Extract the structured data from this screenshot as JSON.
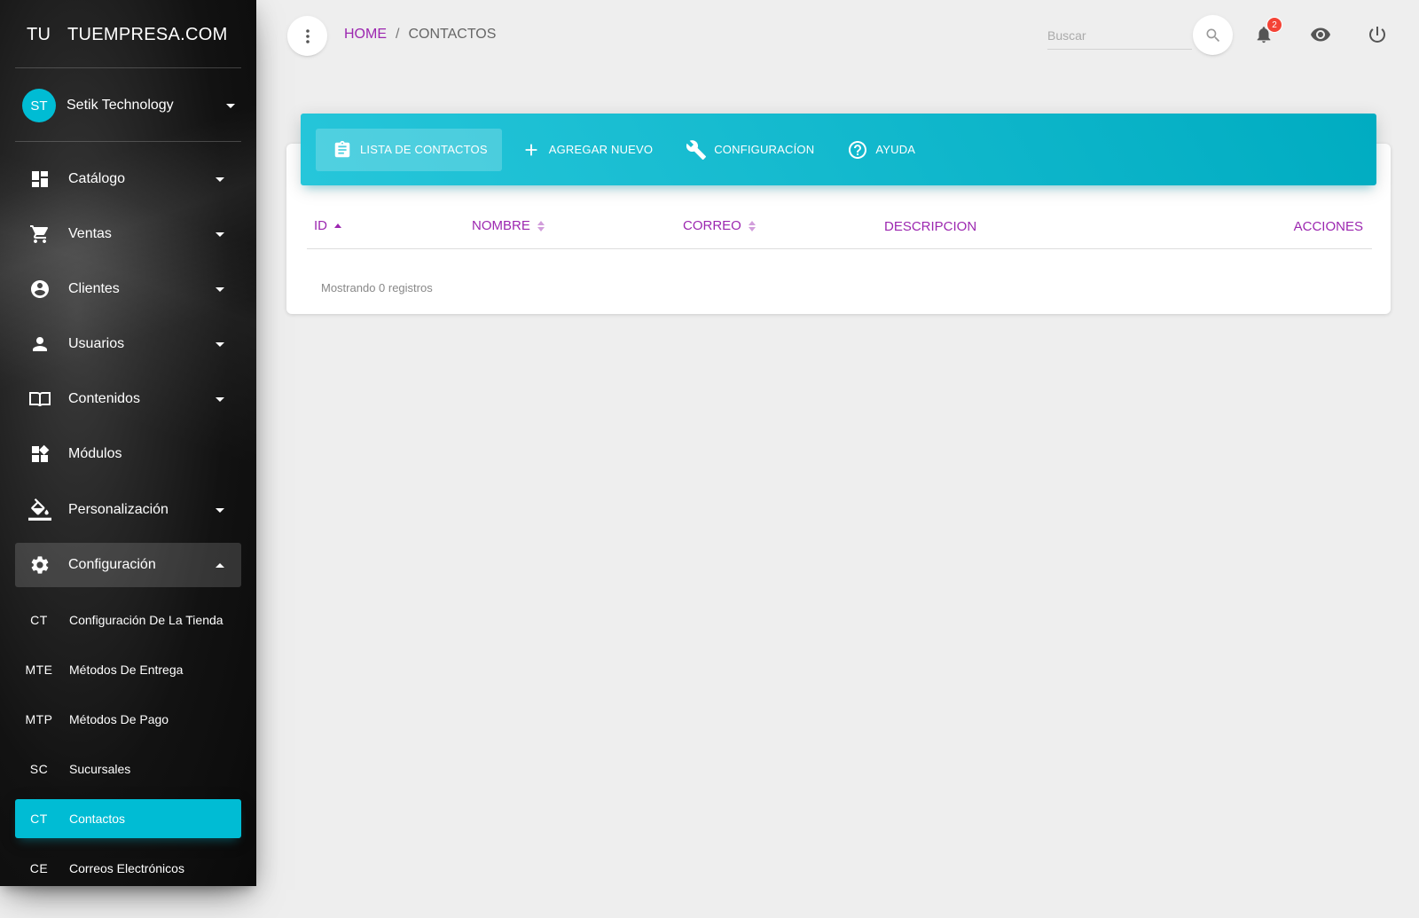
{
  "brand": {
    "mini": "TU",
    "name": "TUEMPRESA.COM"
  },
  "user": {
    "initials": "ST",
    "name": "Setik Technology"
  },
  "nav": {
    "items": [
      {
        "label": "Catálogo",
        "icon": "dashboard-icon"
      },
      {
        "label": "Ventas",
        "icon": "cart-icon"
      },
      {
        "label": "Clientes",
        "icon": "account-circle-icon"
      },
      {
        "label": "Usuarios",
        "icon": "person-icon"
      },
      {
        "label": "Contenidos",
        "icon": "book-icon"
      },
      {
        "label": "Módulos",
        "icon": "widgets-icon"
      },
      {
        "label": "Personalización",
        "icon": "paint-bucket-icon"
      },
      {
        "label": "Configuración",
        "icon": "gear-icon"
      }
    ],
    "sub_items": [
      {
        "abbr": "CT",
        "label": "Configuración De La Tienda"
      },
      {
        "abbr": "MTE",
        "label": "Métodos De Entrega"
      },
      {
        "abbr": "MTP",
        "label": "Métodos De Pago"
      },
      {
        "abbr": "SC",
        "label": "Sucursales"
      },
      {
        "abbr": "CT",
        "label": "Contactos"
      },
      {
        "abbr": "CE",
        "label": "Correos Electrónicos"
      }
    ]
  },
  "breadcrumb": {
    "home": "HOME",
    "separator": "/",
    "current": "CONTACTOS"
  },
  "search": {
    "placeholder": "Buscar"
  },
  "notifications": {
    "count": "2"
  },
  "tabs": [
    {
      "label": "LISTA DE CONTACTOS",
      "icon": "clipboard-icon"
    },
    {
      "label": "AGREGAR NUEVO",
      "icon": "plus-icon"
    },
    {
      "label": "CONFIGURACÍON",
      "icon": "wrench-icon"
    },
    {
      "label": "AYUDA",
      "icon": "help-circle-icon"
    }
  ],
  "table": {
    "columns": [
      "ID",
      "NOMBRE",
      "CORREO",
      "DESCRIPCION",
      "ACCIONES"
    ],
    "rows": [],
    "footer": "Mostrando 0 registros"
  },
  "colors": {
    "accent": "#00bcd4",
    "header": "#9c27b0",
    "badge": "#f44336"
  }
}
